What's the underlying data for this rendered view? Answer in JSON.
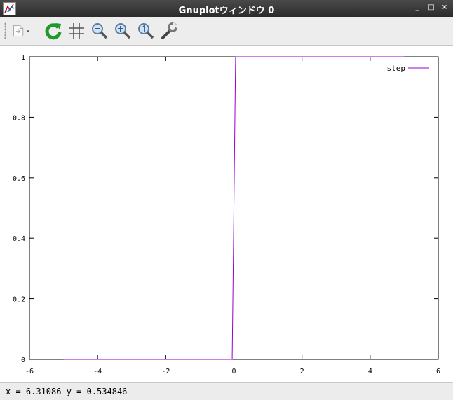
{
  "window": {
    "title": "Gnuplotウィンドウ 0",
    "controls": {
      "minimize": "_",
      "maximize": "□",
      "close": "×"
    }
  },
  "toolbar": {
    "buttons": [
      {
        "name": "export",
        "icon": "export-document-icon"
      },
      {
        "name": "replot",
        "icon": "refresh-icon"
      },
      {
        "name": "grid",
        "icon": "grid-icon"
      },
      {
        "name": "zoom-out",
        "icon": "zoom-out-icon"
      },
      {
        "name": "zoom-in",
        "icon": "zoom-in-icon"
      },
      {
        "name": "zoom-reset",
        "icon": "zoom-reset-icon"
      },
      {
        "name": "settings",
        "icon": "wrench-icon"
      }
    ]
  },
  "status": {
    "text": "x = 6.31086 y = 0.534846"
  },
  "colors": {
    "series": "#9400d3"
  },
  "chart_data": {
    "type": "line",
    "title": "",
    "xlabel": "",
    "ylabel": "",
    "xlim": [
      -6,
      6
    ],
    "ylim": [
      0,
      1
    ],
    "xticks": [
      "-6",
      "-4",
      "-2",
      "0",
      "2",
      "4",
      "6"
    ],
    "yticks": [
      "0",
      "0.2",
      "0.4",
      "0.6",
      "0.8",
      "1"
    ],
    "grid": false,
    "legend": "top-right",
    "series": [
      {
        "name": "step",
        "x": [
          -5,
          -0.05,
          0.05,
          5
        ],
        "y": [
          0,
          0,
          1,
          1
        ]
      }
    ]
  }
}
